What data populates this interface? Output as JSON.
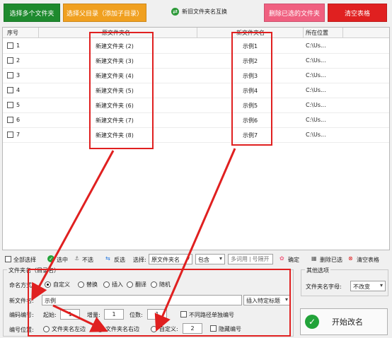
{
  "toolbar": {
    "add_multiple": "选择多个文件夹",
    "add_parent": "选择父目录（添加子目录）",
    "swap": "新旧文件夹名互换",
    "delete_selected": "删除已选的文件夹",
    "clear_table": "清空表格"
  },
  "table": {
    "headers": [
      "序号",
      "原文件夹名",
      "新文件夹名",
      "所在位置"
    ],
    "rows": [
      {
        "num": "1",
        "old": "新建文件夹 (2)",
        "new": "示例1",
        "loc": "C:\\Us..."
      },
      {
        "num": "2",
        "old": "新建文件夹 (3)",
        "new": "示例2",
        "loc": "C:\\Us..."
      },
      {
        "num": "3",
        "old": "新建文件夹 (4)",
        "new": "示例3",
        "loc": "C:\\Us..."
      },
      {
        "num": "4",
        "old": "新建文件夹 (5)",
        "new": "示例4",
        "loc": "C:\\Us..."
      },
      {
        "num": "5",
        "old": "新建文件夹 (6)",
        "new": "示例5",
        "loc": "C:\\Us..."
      },
      {
        "num": "6",
        "old": "新建文件夹 (7)",
        "new": "示例6",
        "loc": "C:\\Us..."
      },
      {
        "num": "7",
        "old": "新建文件夹 (8)",
        "new": "示例7",
        "loc": "C:\\Us..."
      }
    ]
  },
  "selection_bar": {
    "select_all": "全部选择",
    "select": "选中",
    "unselect": "不选",
    "invert": "反选",
    "choose_label": "选择:",
    "field_value": "原文件夹名",
    "match_value": "包含",
    "keyword_placeholder": "多词用 | 号隔开",
    "confirm": "确定",
    "delete_selected": "删除已选",
    "clear_table": "清空表格"
  },
  "rename_panel": {
    "group_title": "文件夹名（目录名）",
    "mode_label": "命名方式:",
    "modes": [
      "自定义",
      "替换",
      "插入",
      "翻译",
      "随机"
    ],
    "new_name_label": "新文件名:",
    "new_name_value": "示例",
    "insert_title": "插入特定标题",
    "numbering_label": "编码编号:",
    "start_label": "起始:",
    "start_value": "1",
    "increment_label": "增量:",
    "increment_value": "1",
    "digits_label": "位数:",
    "digits_value": "1",
    "separate_paths": "不同路径单独编号",
    "position_label": "编号位置:",
    "pos_left": "文件夹名左边",
    "pos_right": "文件夹名右边",
    "pos_custom": "自定义:",
    "custom_value": "2",
    "hide_number": "隐藏编号"
  },
  "other_options": {
    "title": "其他选项",
    "case_label": "文件夹名字母:",
    "case_value": "不改变",
    "start_button": "开始改名"
  },
  "colors": {
    "green": "#1e8a2e",
    "orange": "#f0a020",
    "pink": "#f06080",
    "red": "#e02020",
    "highlight": "#e02020"
  }
}
